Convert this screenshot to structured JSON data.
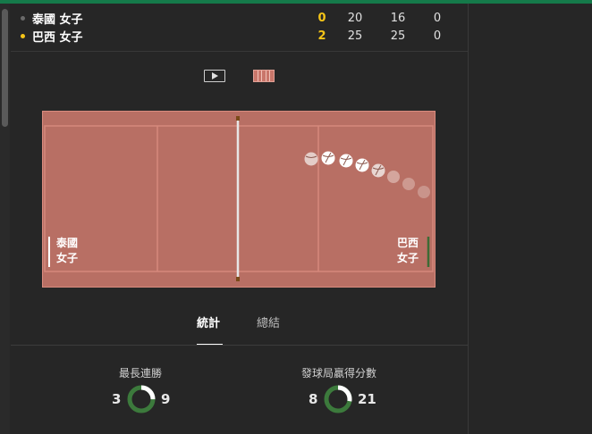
{
  "scoreboard": {
    "rows": [
      {
        "team": "泰國 女子",
        "sets": "0",
        "set1": "20",
        "set2": "16",
        "set3": "0",
        "dot_color": "#6a6a6a"
      },
      {
        "team": "巴西 女子",
        "sets": "2",
        "set1": "25",
        "set2": "25",
        "set3": "0",
        "dot_color": "#f5c518"
      }
    ]
  },
  "court": {
    "left_team_line1": "泰國",
    "left_team_line2": "女子",
    "right_team_line1": "巴西",
    "right_team_line2": "女子",
    "court_color": "#b86f64",
    "left_marker_color": "#ffffff",
    "right_marker_color": "#3d6b35"
  },
  "tabs": {
    "stats": "統計",
    "summary": "總結"
  },
  "stats": {
    "longest_streak": {
      "title": "最長連勝",
      "left": "3",
      "right": "9",
      "left_fraction": 0.25
    },
    "serve_points": {
      "title": "發球局贏得分數",
      "left": "8",
      "right": "21",
      "left_fraction": 0.276
    }
  },
  "colors": {
    "accent_green": "#157a4a",
    "donut_green": "#3c7a3c",
    "donut_white": "#ffffff"
  }
}
